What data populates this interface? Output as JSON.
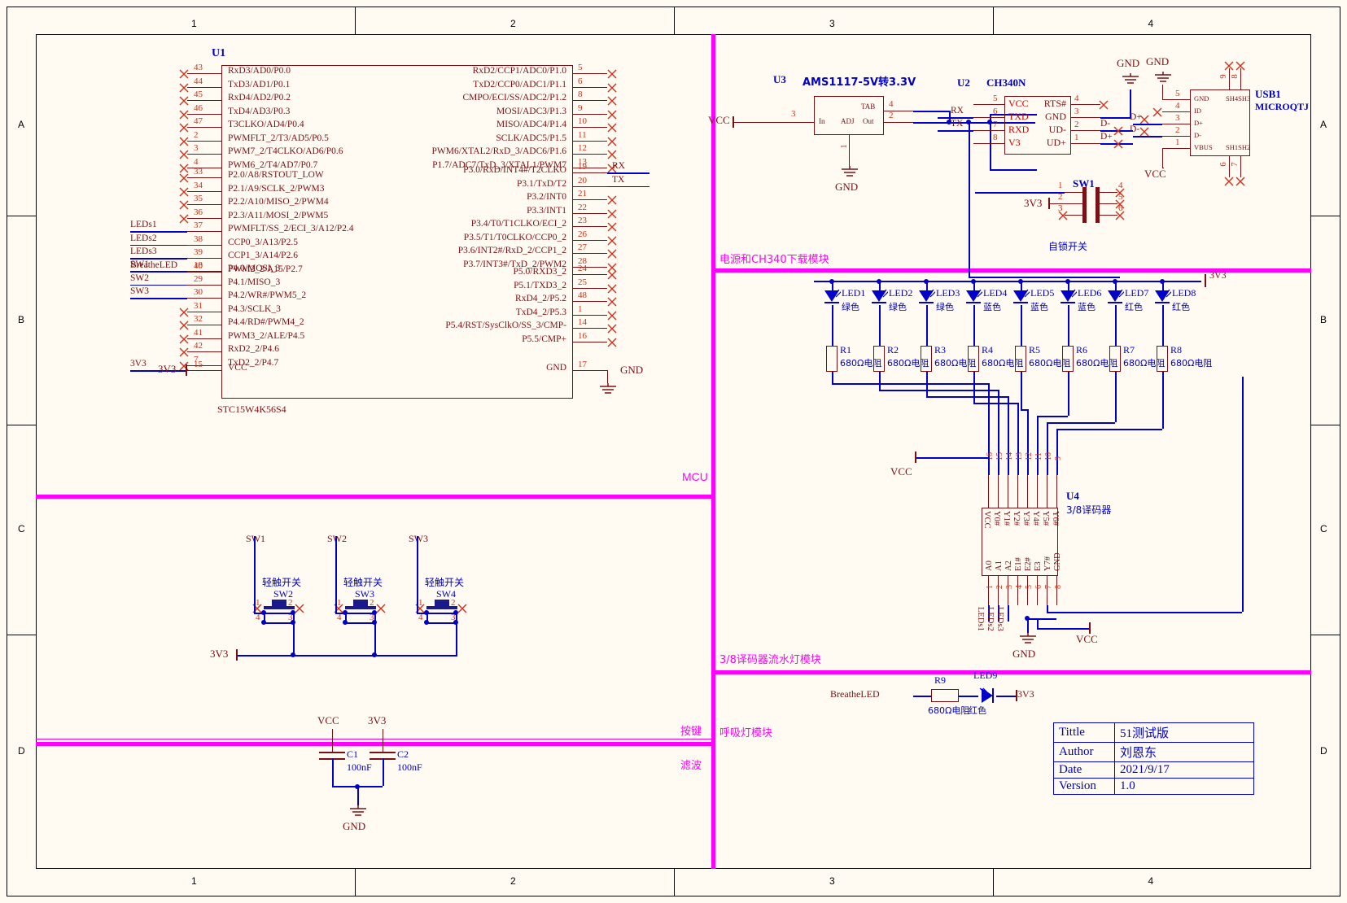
{
  "sheet": {
    "zone_cols": [
      "1",
      "2",
      "3",
      "4"
    ],
    "zone_rows": [
      "A",
      "B",
      "C",
      "D"
    ]
  },
  "modules": {
    "mcu": "MCU",
    "power": "电源和CH340下载模块",
    "decoder": "3/8译码器流水灯模块",
    "keys": "按键",
    "breathe": "呼吸灯模块",
    "filter": "滤波"
  },
  "u1": {
    "ref": "U1",
    "part": "STC15W4K56S4",
    "left_groups": [
      {
        "pins": [
          {
            "num": "43",
            "label": "RxD3/AD0/P0.0"
          },
          {
            "num": "44",
            "label": "TxD3/AD1/P0.1"
          },
          {
            "num": "45",
            "label": "RxD4/AD2/P0.2"
          },
          {
            "num": "46",
            "label": "TxD4/AD3/P0.3"
          },
          {
            "num": "47",
            "label": "T3CLKO/AD4/P0.4"
          },
          {
            "num": "2",
            "label": "PWMFLT_2/T3/AD5/P0.5"
          },
          {
            "num": "3",
            "label": "PWM7_2/T4CLKO/AD6/P0.6"
          },
          {
            "num": "4",
            "label": "PWM6_2/T4/AD7/P0.7"
          }
        ]
      },
      {
        "pins": [
          {
            "num": "33",
            "label": "P2.0/A8/RSTOUT_LOW"
          },
          {
            "num": "34",
            "label": "P2.1/A9/SCLK_2/PWM3"
          },
          {
            "num": "35",
            "label": "P2.2/A10/MISO_2/PWM4"
          },
          {
            "num": "36",
            "label": "P2.3/A11/MOSI_2/PWM5"
          },
          {
            "num": "37",
            "label": "PWMFLT/SS_2/ECI_3/A12/P2.4",
            "net": "LEDs1"
          },
          {
            "num": "38",
            "label": "CCP0_3/A13/P2.5",
            "net": "LEDs2"
          },
          {
            "num": "39",
            "label": "CCP1_3/A14/P2.6",
            "net": "LEDs3"
          },
          {
            "num": "40",
            "label": "PWM2_2/A15/P2.7",
            "net": "BreatheLED"
          }
        ]
      },
      {
        "pins": [
          {
            "num": "18",
            "label": "P4.0/MOSI_3",
            "net": "SW1"
          },
          {
            "num": "29",
            "label": "P4.1/MISO_3",
            "net": "SW2"
          },
          {
            "num": "30",
            "label": "P4.2/WR#/PWM5_2",
            "net": "SW3"
          },
          {
            "num": "31",
            "label": "P4.3/SCLK_3"
          },
          {
            "num": "32",
            "label": "P4.4/RD#/PWM4_2"
          },
          {
            "num": "41",
            "label": "PWM3_2/ALE/P4.5"
          },
          {
            "num": "42",
            "label": "RxD2_2/P4.6"
          },
          {
            "num": "7",
            "label": "TxD2_2/P4.7"
          }
        ]
      },
      {
        "pins": [
          {
            "num": "15",
            "label": "VCC",
            "net": "3V3"
          }
        ]
      }
    ],
    "right_groups": [
      {
        "pins": [
          {
            "num": "5",
            "label": "RxD2/CCP1/ADC0/P1.0"
          },
          {
            "num": "6",
            "label": "TxD2/CCP0/ADC1/P1.1"
          },
          {
            "num": "8",
            "label": "CMPO/ECI/SS/ADC2/P1.2"
          },
          {
            "num": "9",
            "label": "MOSI/ADC3/P1.3"
          },
          {
            "num": "10",
            "label": "MISO/ADC4/P1.4"
          },
          {
            "num": "11",
            "label": "SCLK/ADC5/P1.5"
          },
          {
            "num": "12",
            "label": "PWM6/XTAL2/RxD_3/ADC6/P1.6"
          },
          {
            "num": "13",
            "label": "P1.7/ADC7/TxD_3/XTAL1/PWM7"
          }
        ]
      },
      {
        "pins": [
          {
            "num": "19",
            "label": "P3.0/RxD/INT4#/T2CLKO",
            "net": "RX"
          },
          {
            "num": "20",
            "label": "P3.1/TxD/T2",
            "net": "TX"
          },
          {
            "num": "21",
            "label": "P3.2/INT0"
          },
          {
            "num": "22",
            "label": "P3.3/INT1"
          },
          {
            "num": "23",
            "label": "P3.4/T0/T1CLKO/ECI_2"
          },
          {
            "num": "26",
            "label": "P3.5/T1/T0CLKO/CCP0_2"
          },
          {
            "num": "27",
            "label": "P3.6/INT2#/RxD_2/CCP1_2"
          },
          {
            "num": "28",
            "label": "P3.7/INT3#/TxD_2/PWM2"
          }
        ]
      },
      {
        "pins": [
          {
            "num": "24",
            "label": "P5.0/RXD3_2"
          },
          {
            "num": "25",
            "label": "P5.1/TXD3_2"
          },
          {
            "num": "48",
            "label": "RxD4_2/P5.2"
          },
          {
            "num": "1",
            "label": "TxD4_2/P5.3"
          },
          {
            "num": "14",
            "label": "P5.4/RST/SysClkO/SS_3/CMP-"
          },
          {
            "num": "16",
            "label": "P5.5/CMP+"
          }
        ]
      },
      {
        "pins": [
          {
            "num": "17",
            "label": "GND",
            "net": "GND"
          }
        ]
      }
    ]
  },
  "u3": {
    "ref": "U3",
    "part": "AMS1117-5V转3.3V",
    "pins_left": [
      {
        "num": "3",
        "label": "In"
      }
    ],
    "pins_mid": [
      {
        "num": "1",
        "label": "ADJ"
      }
    ],
    "pins_right": [
      {
        "num": "4",
        "label": "TAB"
      },
      {
        "num": "2",
        "label": "Out"
      }
    ],
    "net_in": "VCC",
    "net_gnd": "GND"
  },
  "u2": {
    "ref": "U2",
    "part": "CH340N",
    "left_pins": [
      {
        "num": "5",
        "label": "VCC"
      },
      {
        "num": "6",
        "label": "TXD",
        "net": "RX"
      },
      {
        "num": "7",
        "label": "RXD",
        "net": "TX"
      },
      {
        "num": "8",
        "label": "V3"
      }
    ],
    "right_pins": [
      {
        "num": "4",
        "label": "RTS#"
      },
      {
        "num": "3",
        "label": "GND"
      },
      {
        "num": "2",
        "label": "UD-",
        "net": "D-"
      },
      {
        "num": "1",
        "label": "UD+",
        "net": "D+"
      }
    ],
    "net_gnd": "GND"
  },
  "usb1": {
    "ref": "USB1",
    "part": "MICROQTJ",
    "left_pins": [
      {
        "num": "5",
        "label": "GND",
        "net": "GND"
      },
      {
        "num": "4",
        "label": "ID"
      },
      {
        "num": "3",
        "label": "D+",
        "net": "D+"
      },
      {
        "num": "2",
        "label": "D-",
        "net": "D-"
      },
      {
        "num": "1",
        "label": "VBUS",
        "net": "VCC"
      }
    ],
    "shield_top_labels": [
      "SH4",
      "SH3"
    ],
    "shield_top_nums": [
      "9",
      "8"
    ],
    "shield_bot_labels": [
      "SH1",
      "SH2"
    ],
    "shield_bot_nums": [
      "6",
      "7"
    ]
  },
  "sw1": {
    "ref": "SW1",
    "part": "自锁开关",
    "pins": [
      "1",
      "2",
      "3",
      "4",
      "5",
      "6"
    ],
    "net": "3V3"
  },
  "leds": {
    "rail_net": "3V3",
    "items": [
      {
        "ref": "LED1",
        "color_cn": "绿色",
        "res": "R1",
        "res_val": "680Ω电阻"
      },
      {
        "ref": "LED2",
        "color_cn": "绿色",
        "res": "R2",
        "res_val": "680Ω电阻"
      },
      {
        "ref": "LED3",
        "color_cn": "绿色",
        "res": "R3",
        "res_val": "680Ω电阻"
      },
      {
        "ref": "LED4",
        "color_cn": "蓝色",
        "res": "R4",
        "res_val": "680Ω电阻"
      },
      {
        "ref": "LED5",
        "color_cn": "蓝色",
        "res": "R5",
        "res_val": "680Ω电阻"
      },
      {
        "ref": "LED6",
        "color_cn": "蓝色",
        "res": "R6",
        "res_val": "680Ω电阻"
      },
      {
        "ref": "LED7",
        "color_cn": "红色",
        "res": "R7",
        "res_val": "680Ω电阻"
      },
      {
        "ref": "LED8",
        "color_cn": "红色",
        "res": "R8",
        "res_val": "680Ω电阻"
      }
    ]
  },
  "u4": {
    "ref": "U4",
    "part": "3/8译码器",
    "top_pins": [
      {
        "num": "16",
        "label": "VCC",
        "net": "VCC"
      },
      {
        "num": "15",
        "label": "Y0#"
      },
      {
        "num": "14",
        "label": "Y1#"
      },
      {
        "num": "13",
        "label": "Y2#"
      },
      {
        "num": "12",
        "label": "Y3#"
      },
      {
        "num": "11",
        "label": "Y4#"
      },
      {
        "num": "10",
        "label": "Y5#"
      },
      {
        "num": "9",
        "label": "Y6#"
      }
    ],
    "bot_pins": [
      {
        "num": "1",
        "label": "A0",
        "net": "LEDs1"
      },
      {
        "num": "2",
        "label": "A1",
        "net": "LEDs2"
      },
      {
        "num": "3",
        "label": "A2",
        "net": "LEDs3"
      },
      {
        "num": "4",
        "label": "E1#"
      },
      {
        "num": "5",
        "label": "E2#"
      },
      {
        "num": "6",
        "label": "E3"
      },
      {
        "num": "7",
        "label": "Y7#"
      },
      {
        "num": "8",
        "label": "GND"
      }
    ],
    "net_gnd": "GND",
    "net_vcc": "VCC"
  },
  "keys": {
    "nets": [
      "SW1",
      "SW2",
      "SW3"
    ],
    "rail": "3V3",
    "switches": [
      {
        "ref": "SW2",
        "part": "轻触开关",
        "pins": [
          "1",
          "2",
          "3",
          "4"
        ]
      },
      {
        "ref": "SW3",
        "part": "轻触开关",
        "pins": [
          "1",
          "2",
          "3",
          "4"
        ]
      },
      {
        "ref": "SW4",
        "part": "轻触开关",
        "pins": [
          "1",
          "2",
          "3",
          "4"
        ]
      }
    ]
  },
  "breathe": {
    "net": "BreatheLED",
    "res": "R9",
    "res_val": "680Ω电阻",
    "led": "LED9",
    "led_color": "红色",
    "rail": "3V3"
  },
  "filter": {
    "caps": [
      {
        "ref": "C1",
        "val": "100nF",
        "net": "VCC"
      },
      {
        "ref": "C2",
        "val": "100nF",
        "net": "3V3"
      }
    ],
    "gnd": "GND"
  },
  "title_block": {
    "rows": [
      {
        "key": "Tittle",
        "value": "51测试版"
      },
      {
        "key": "Author",
        "value": "刘恩东"
      },
      {
        "key": "Date",
        "value": "2021/9/17"
      },
      {
        "key": "Version",
        "value": "1.0"
      }
    ]
  },
  "colors": {
    "wire": "#0000c8",
    "symbol": "#7b0f14",
    "module": "#ff00ff",
    "pin_number": "#d03018",
    "background": "#fffbf2"
  }
}
